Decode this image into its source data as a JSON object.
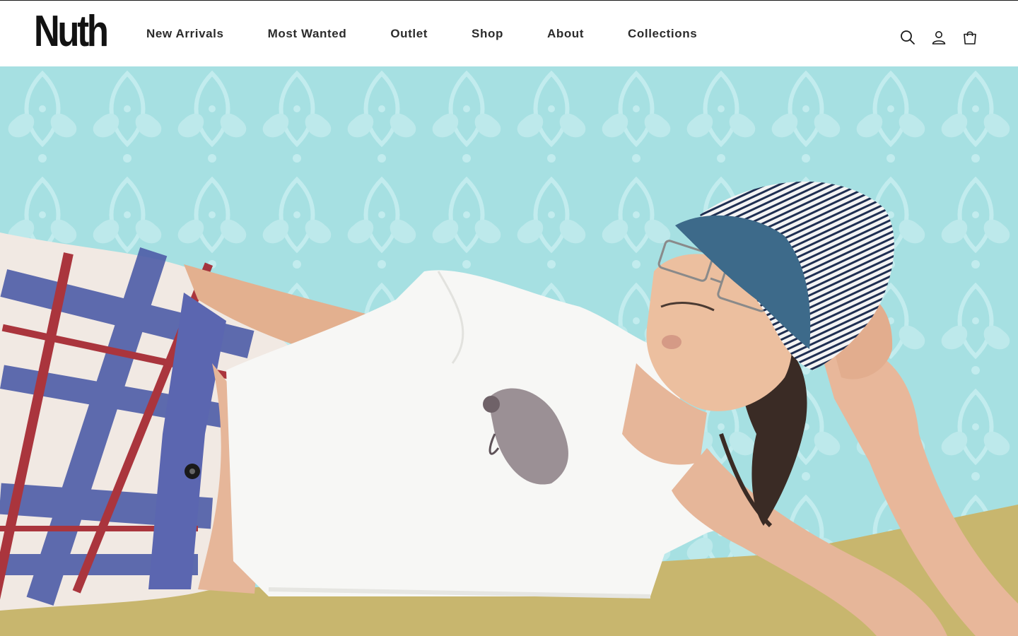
{
  "brand": {
    "logo_text": "Nuth"
  },
  "nav": {
    "items": [
      {
        "label": "New Arrivals"
      },
      {
        "label": "Most Wanted"
      },
      {
        "label": "Outlet"
      },
      {
        "label": "Shop"
      },
      {
        "label": "About"
      },
      {
        "label": "Collections"
      }
    ]
  },
  "header_icons": {
    "search": "search-icon",
    "account": "account-icon",
    "cart": "cart-icon"
  },
  "hero": {
    "image": "hero-model-image",
    "colors": {
      "wallpaper": "#a6e0e2",
      "floor": "#c8b66e",
      "tshirt": "#f7f7f5",
      "cap_stripes": "#1f2f52",
      "cap_brim": "#3d6a8a",
      "pants_blue": "#4e5da8",
      "pants_red": "#a3222c"
    }
  }
}
